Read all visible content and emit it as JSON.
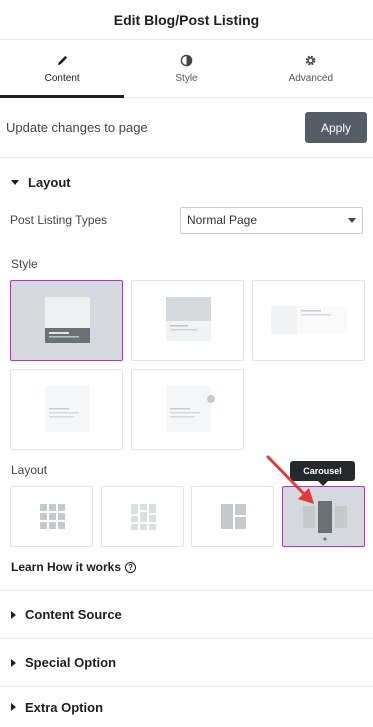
{
  "header": {
    "title": "Edit Blog/Post Listing"
  },
  "tabs": [
    {
      "label": "Content",
      "icon": "pencil-icon",
      "active": true
    },
    {
      "label": "Style",
      "icon": "half-circle-icon",
      "active": false
    },
    {
      "label": "Advanced",
      "icon": "gear-icon",
      "active": false
    }
  ],
  "update": {
    "text": "Update changes to page",
    "button": "Apply"
  },
  "layout_section": {
    "title": "Layout",
    "post_listing_label": "Post Listing Types",
    "post_listing_value": "Normal Page",
    "style_label": "Style",
    "layout_label": "Layout",
    "style_selected_index": 0,
    "layout_selected_index": 3,
    "tooltip": "Carousel",
    "learn_label": "Learn How it works",
    "help_glyph": "?"
  },
  "sections": [
    {
      "title": "Content Source"
    },
    {
      "title": "Special Option"
    },
    {
      "title": "Extra Option"
    }
  ],
  "colors": {
    "accent": "#b72fd0",
    "apply_bg": "#555d66",
    "arrow": "#e03a3a"
  }
}
